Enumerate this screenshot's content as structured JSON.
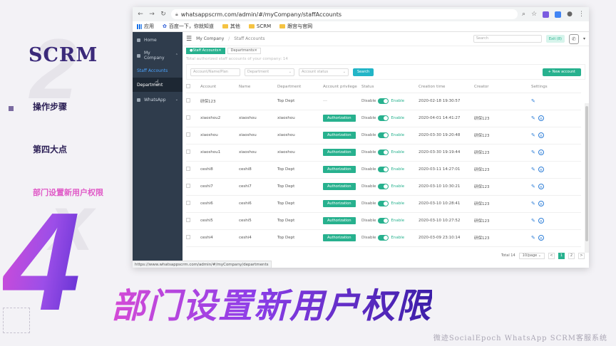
{
  "slide": {
    "title": "SCRM",
    "step_label": "操作步骤",
    "section_label": "第四大点",
    "highlight_label": "部门设置新用户权限",
    "big_number": "4",
    "banner": "部门设置新用户权限",
    "footer": "微迹SocialEpoch WhatsApp SCRM客服系统",
    "deco_digit": "2",
    "deco_letter": "x"
  },
  "browser": {
    "url": "whatsappscrm.com/admin/#/myCompany/staffAccounts",
    "bookmarks": [
      "应用",
      "百度一下，你就知道",
      "其他",
      "SCRM",
      "跟宫与官网"
    ],
    "status_url": "https://www.whatsappscrm.com/admin/#/myCompany/departments"
  },
  "sidebar": {
    "home": "Home",
    "my_company": "My Company",
    "staff_accounts": "Staff Accounts",
    "department": "Department",
    "whatsapp": "WhatsApp"
  },
  "topbar": {
    "breadcrumb": [
      "My Company",
      "Staff Accounts"
    ],
    "search_placeholder": "Search",
    "exit_label": "Exit (8)"
  },
  "tags": [
    "Staff Accounts",
    "Departments"
  ],
  "info_line": "Total authorized staff accounts of your company: 14",
  "filters": {
    "account_placeholder": "Account/Name/Plan",
    "department_placeholder": "Department",
    "status_placeholder": "Account status",
    "search_label": "Search",
    "new_label": "+ New account"
  },
  "table": {
    "headers": [
      "Account",
      "Name",
      "Department",
      "Account privilege",
      "Status",
      "Creation time",
      "Creator",
      "Settings"
    ],
    "authorization_label": "Authorization",
    "disable_label": "Disable",
    "enable_label": "Enable",
    "rows": [
      {
        "account": "研保123",
        "name": "",
        "department": "Top Dept",
        "privilege": "---",
        "created": "2020-02-18 19:30:57",
        "creator": ""
      },
      {
        "account": "xiaoshou2",
        "name": "xiaoshou",
        "department": "xiaoshou",
        "privilege": "auth",
        "created": "2020-04-01 14:41:27",
        "creator": "研保123"
      },
      {
        "account": "xiaoshou",
        "name": "xiaoshou",
        "department": "xiaoshou",
        "privilege": "auth",
        "created": "2020-03-30 19:20:48",
        "creator": "研保123"
      },
      {
        "account": "xiaoshou1",
        "name": "xiaoshou",
        "department": "xiaoshou",
        "privilege": "auth",
        "created": "2020-03-30 19:19:44",
        "creator": "研保123"
      },
      {
        "account": "ceshi8",
        "name": "ceshi8",
        "department": "Top Dept",
        "privilege": "auth",
        "created": "2020-03-11 14:27:01",
        "creator": "研保123"
      },
      {
        "account": "ceshi7",
        "name": "ceshi7",
        "department": "Top Dept",
        "privilege": "auth",
        "created": "2020-03-10 10:30:21",
        "creator": "研保123"
      },
      {
        "account": "ceshi6",
        "name": "ceshi6",
        "department": "Top Dept",
        "privilege": "auth",
        "created": "2020-03-10 10:28:41",
        "creator": "研保123"
      },
      {
        "account": "ceshi5",
        "name": "ceshi5",
        "department": "Top Dept",
        "privilege": "auth",
        "created": "2020-03-10 10:27:52",
        "creator": "研保123"
      },
      {
        "account": "ceshi4",
        "name": "ceshi4",
        "department": "Top Dept",
        "privilege": "auth",
        "created": "2020-03-09 23:10:14",
        "creator": "研保123"
      }
    ]
  },
  "pager": {
    "total": "Total 14",
    "page_size": "10/page",
    "pages": [
      "1",
      "2"
    ],
    "prev": "<",
    "next": ">"
  },
  "colors": {
    "accent": "#27b18e",
    "sidebar": "#2f3c4c",
    "banner_start": "#d54bd6",
    "banner_end": "#3c1ea8"
  }
}
